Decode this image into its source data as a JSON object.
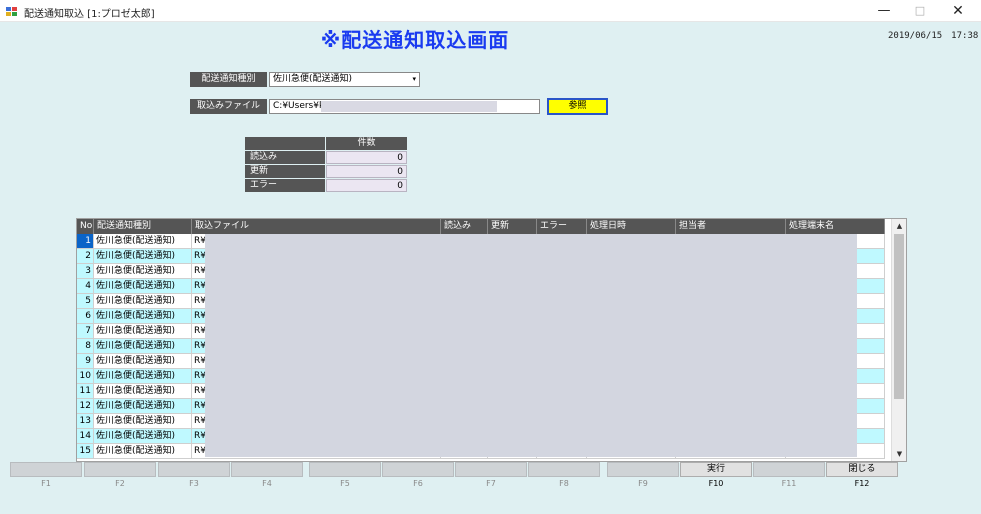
{
  "window": {
    "title": "配送通知取込 [1:プロゼ太郎]",
    "min_icon": "—",
    "max_icon": "□",
    "close_icon": "✕"
  },
  "header": {
    "title": "※配送通知取込画面",
    "datetime": "2019/06/15　17:38"
  },
  "form": {
    "type_label": "配送通知種別",
    "type_value": "佐川急便(配送通知)",
    "type_arrow": "▾",
    "file_label": "取込みファイル",
    "file_value": "C:¥Users¥k",
    "browse_label": "参照"
  },
  "counts": {
    "header": "件数",
    "rows": [
      {
        "label": "読込み",
        "value": "0"
      },
      {
        "label": "更新",
        "value": "0"
      },
      {
        "label": "エラー",
        "value": "0"
      }
    ]
  },
  "grid": {
    "columns": [
      "No",
      "配送通知種別",
      "取込ファイル",
      "読込み",
      "更新",
      "エラー",
      "処理日時",
      "担当者",
      "処理端末名"
    ],
    "rows": [
      {
        "no": "1",
        "type": "佐川急便(配送通知)",
        "file": "R¥"
      },
      {
        "no": "2",
        "type": "佐川急便(配送通知)",
        "file": "R¥"
      },
      {
        "no": "3",
        "type": "佐川急便(配送通知)",
        "file": "R¥"
      },
      {
        "no": "4",
        "type": "佐川急便(配送通知)",
        "file": "R¥"
      },
      {
        "no": "5",
        "type": "佐川急便(配送通知)",
        "file": "R¥"
      },
      {
        "no": "6",
        "type": "佐川急便(配送通知)",
        "file": "R¥"
      },
      {
        "no": "7",
        "type": "佐川急便(配送通知)",
        "file": "R¥"
      },
      {
        "no": "8",
        "type": "佐川急便(配送通知)",
        "file": "R¥"
      },
      {
        "no": "9",
        "type": "佐川急便(配送通知)",
        "file": "R¥"
      },
      {
        "no": "10",
        "type": "佐川急便(配送通知)",
        "file": "R¥"
      },
      {
        "no": "11",
        "type": "佐川急便(配送通知)",
        "file": "R¥"
      },
      {
        "no": "12",
        "type": "佐川急便(配送通知)",
        "file": "R¥"
      },
      {
        "no": "13",
        "type": "佐川急便(配送通知)",
        "file": "R¥"
      },
      {
        "no": "14",
        "type": "佐川急便(配送通知)",
        "file": "R¥"
      },
      {
        "no": "15",
        "type": "佐川急便(配送通知)",
        "file": "R¥"
      }
    ],
    "scroll_up": "▲",
    "scroll_down": "▼"
  },
  "function_keys": [
    {
      "key": "F1",
      "label": ""
    },
    {
      "key": "F2",
      "label": ""
    },
    {
      "key": "F3",
      "label": ""
    },
    {
      "key": "F4",
      "label": ""
    },
    {
      "key": "F5",
      "label": ""
    },
    {
      "key": "F6",
      "label": ""
    },
    {
      "key": "F7",
      "label": ""
    },
    {
      "key": "F8",
      "label": ""
    },
    {
      "key": "F9",
      "label": ""
    },
    {
      "key": "F10",
      "label": "実行"
    },
    {
      "key": "F11",
      "label": ""
    },
    {
      "key": "F12",
      "label": "閉じる"
    }
  ],
  "colors": {
    "background": "#dff0f2",
    "title": "#1a3bf0",
    "label_bg": "#555555",
    "row_cyan": "#bff9ff",
    "selected": "#0a64c8",
    "browse_button": "#ffff00"
  }
}
